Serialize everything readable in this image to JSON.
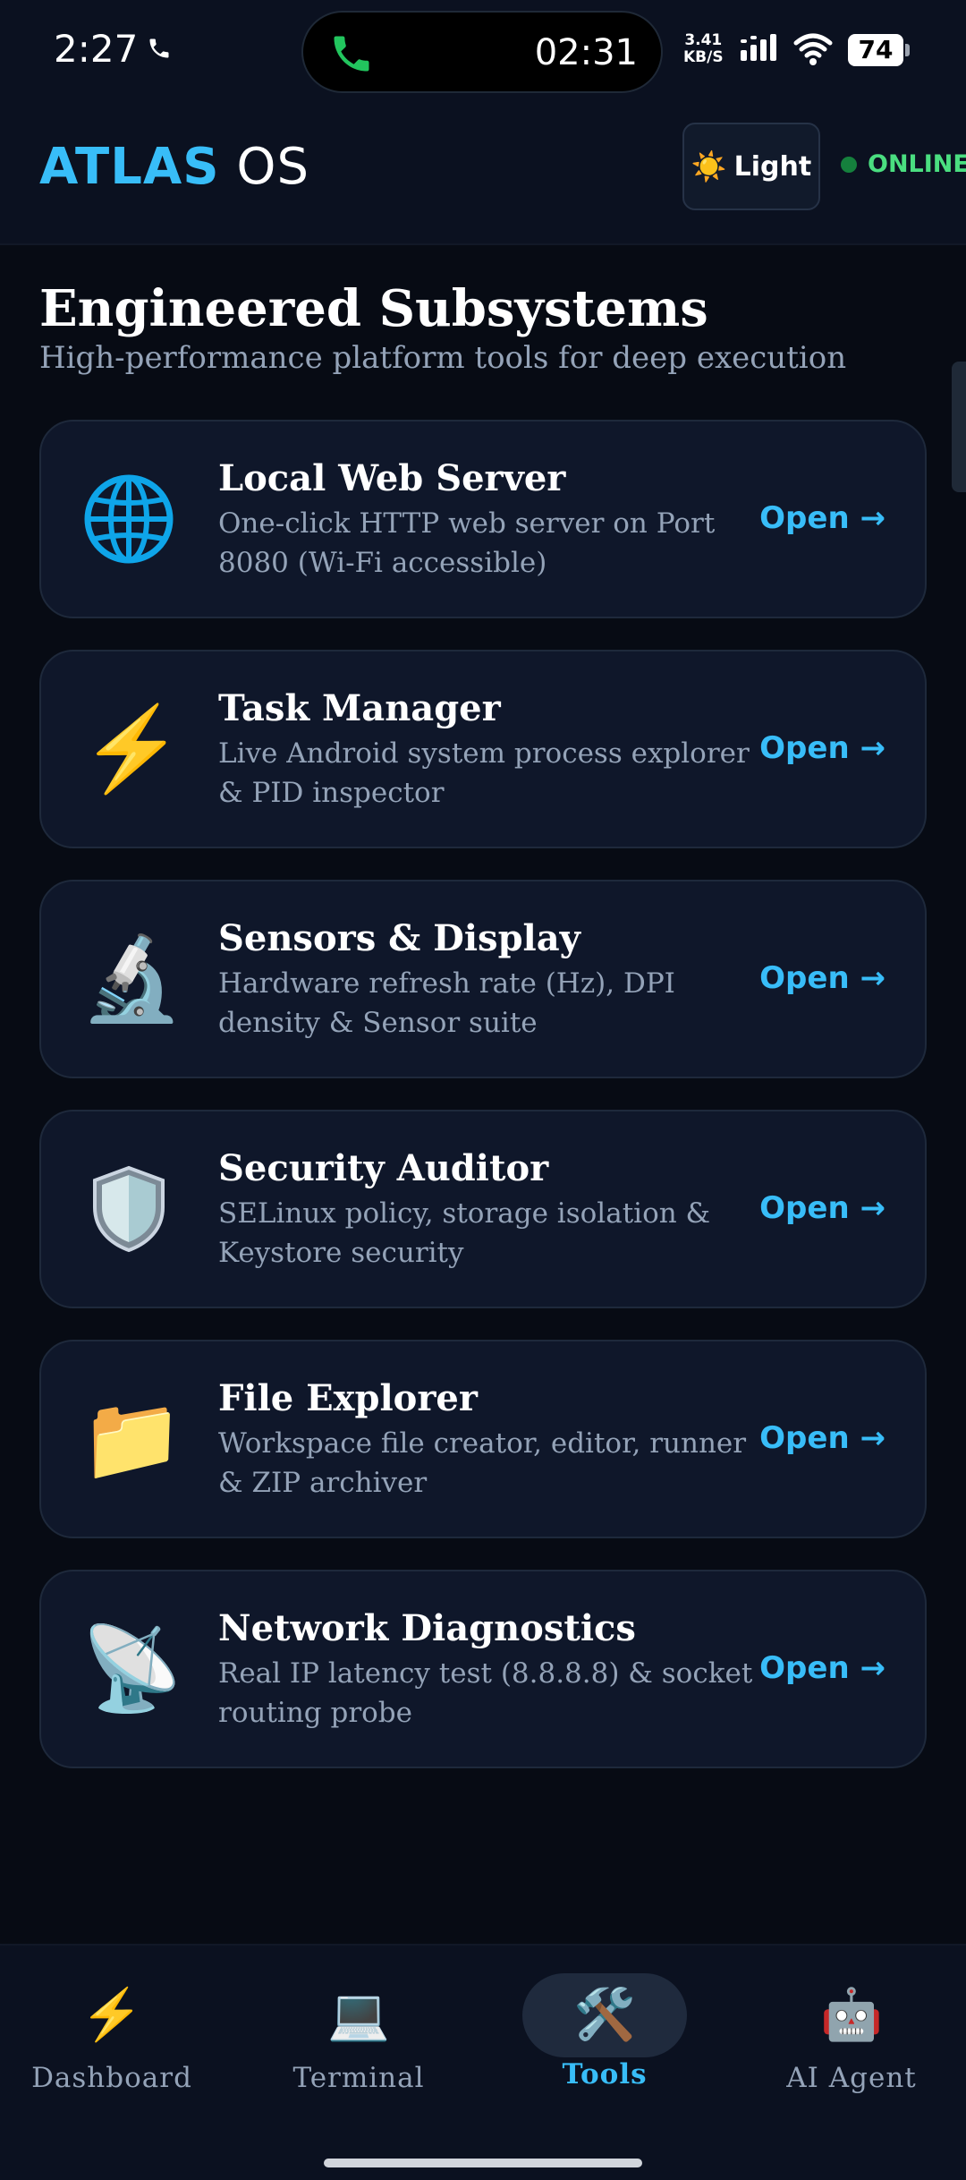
{
  "status_bar": {
    "time": "2:27",
    "call_timer": "02:31",
    "net_speed_value": "3.41",
    "net_speed_unit": "KB/S",
    "battery": "74"
  },
  "header": {
    "brand_primary": "ATLAS",
    "brand_secondary": "OS",
    "theme_icon": "☀️",
    "theme_label": "Light",
    "status_label": "ONLINE"
  },
  "section": {
    "title": "Engineered Subsystems",
    "subtitle": "High-performance platform tools for deep execution"
  },
  "tools": [
    {
      "icon": "globe-icon",
      "glyph": "",
      "title": "Local Web Server",
      "description": "One-click HTTP web server on Port 8080 (Wi-Fi accessible)",
      "action": "Open →"
    },
    {
      "icon": "lightning-icon",
      "glyph": "⚡",
      "title": "Task Manager",
      "description": "Live Android system process explorer & PID inspector",
      "action": "Open →"
    },
    {
      "icon": "microscope-icon",
      "glyph": "🔬",
      "title": "Sensors & Display",
      "description": "Hardware refresh rate (Hz), DPI density & Sensor suite",
      "action": "Open →"
    },
    {
      "icon": "shield-icon",
      "glyph": "",
      "title": "Security Auditor",
      "description": "SELinux policy, storage isolation & Keystore security",
      "action": "Open →"
    },
    {
      "icon": "folder-icon",
      "glyph": "📁",
      "title": "File Explorer",
      "description": "Workspace file creator, editor, runner & ZIP archiver",
      "action": "Open →"
    },
    {
      "icon": "satellite-antenna-icon",
      "glyph": "📡",
      "title": "Network Diagnostics",
      "description": "Real IP latency test (8.8.8.8) & socket routing probe",
      "action": "Open →"
    }
  ],
  "bottom_nav": [
    {
      "icon": "lightning-icon",
      "glyph": "⚡",
      "label": "Dashboard",
      "active": false
    },
    {
      "icon": "laptop-icon",
      "glyph": "💻",
      "label": "Terminal",
      "active": false
    },
    {
      "icon": "tools-icon",
      "glyph": "🛠️",
      "label": "Tools",
      "active": true
    },
    {
      "icon": "robot-icon",
      "glyph": "🤖",
      "label": "AI Agent",
      "active": false
    }
  ],
  "colors": {
    "background": "#070b14",
    "card": "#0f172a",
    "accent": "#38bdf8",
    "online": "#4ade80",
    "muted_text": "#94a3b8"
  }
}
